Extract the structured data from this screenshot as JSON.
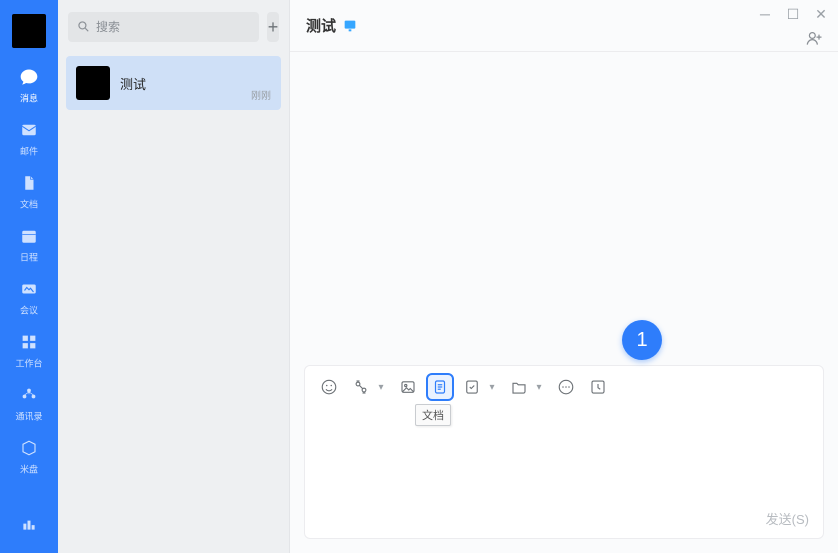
{
  "nav": {
    "items": [
      {
        "key": "messages",
        "label": "消息"
      },
      {
        "key": "mail",
        "label": "邮件"
      },
      {
        "key": "docs",
        "label": "文档"
      },
      {
        "key": "calendar",
        "label": "日程"
      },
      {
        "key": "meeting",
        "label": "会议"
      },
      {
        "key": "workbench",
        "label": "工作台"
      },
      {
        "key": "contacts",
        "label": "通讯录"
      },
      {
        "key": "clouddisk",
        "label": "米盘"
      }
    ]
  },
  "search": {
    "placeholder": "搜索"
  },
  "conversations": [
    {
      "name": "测试",
      "time": "刚刚"
    }
  ],
  "chat": {
    "title": "测试",
    "add_user_label": "添加成员"
  },
  "composer": {
    "tooltip": "文档",
    "send_label": "发送(S)"
  },
  "step_badge": "1",
  "toolbar_icons": {
    "emoji": "emoji-icon",
    "scissors": "scissors-icon",
    "image": "image-icon",
    "doc": "document-icon",
    "task": "task-icon",
    "folder": "folder-icon",
    "more": "more-icon",
    "history": "history-icon"
  },
  "colors": {
    "accent": "#2e7dfb",
    "nav_bg": "#2e7dfb",
    "selection": "#cfe0f7"
  }
}
